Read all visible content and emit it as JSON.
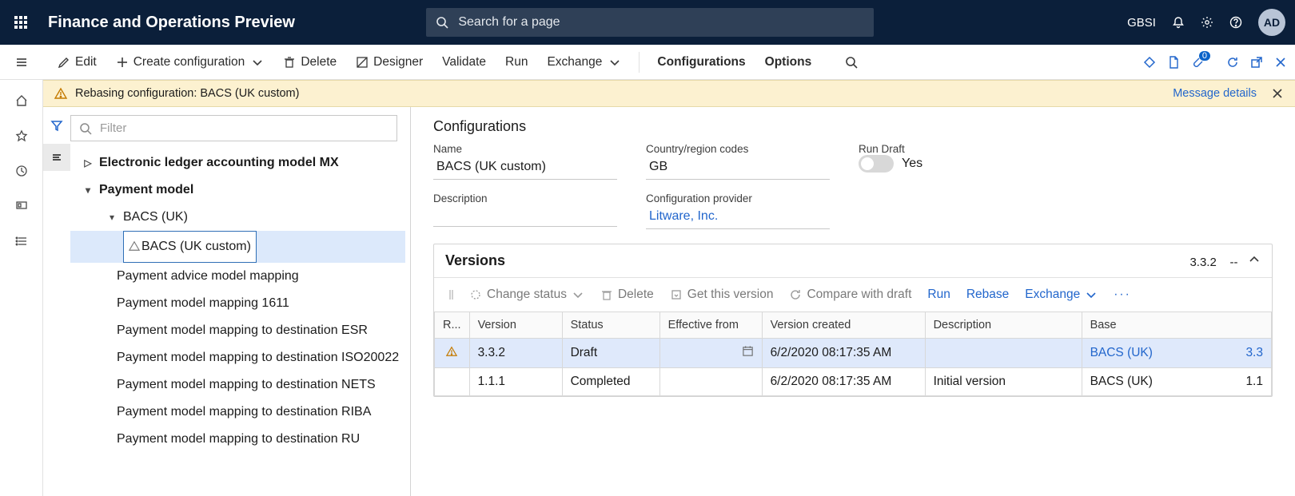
{
  "header": {
    "app_title": "Finance and Operations Preview",
    "search_placeholder": "Search for a page",
    "company": "GBSI",
    "avatar": "AD"
  },
  "commands": {
    "edit": "Edit",
    "create": "Create configuration",
    "delete": "Delete",
    "designer": "Designer",
    "validate": "Validate",
    "run": "Run",
    "exchange": "Exchange",
    "configurations": "Configurations",
    "options": "Options",
    "badge": "0"
  },
  "banner": {
    "text": "Rebasing configuration: BACS (UK custom)",
    "details": "Message details"
  },
  "tree": {
    "filter_placeholder": "Filter",
    "n0": "Electronic ledger accounting model MX",
    "n1": "Payment model",
    "n2": "BACS (UK)",
    "n3": "BACS (UK custom)",
    "c0": "Payment advice model mapping",
    "c1": "Payment model mapping 1611",
    "c2": "Payment model mapping to destination ESR",
    "c3": "Payment model mapping to destination ISO20022",
    "c4": "Payment model mapping to destination NETS",
    "c5": "Payment model mapping to destination RIBA",
    "c6": "Payment model mapping to destination RU"
  },
  "details": {
    "section": "Configurations",
    "labels": {
      "name": "Name",
      "cc": "Country/region codes",
      "run_draft": "Run Draft",
      "desc": "Description",
      "provider": "Configuration provider"
    },
    "name": "BACS (UK custom)",
    "cc": "GB",
    "run_draft": "Yes",
    "provider": "Litware, Inc."
  },
  "versions": {
    "title": "Versions",
    "current": "3.3.2",
    "dash": "--",
    "toolbar": {
      "change": "Change status",
      "delete": "Delete",
      "get": "Get this version",
      "compare": "Compare with draft",
      "run": "Run",
      "rebase": "Rebase",
      "exchange": "Exchange"
    },
    "columns": {
      "r": "R...",
      "ver": "Version",
      "status": "Status",
      "eff": "Effective from",
      "created": "Version created",
      "desc": "Description",
      "base": "Base"
    },
    "rows": [
      {
        "warn": true,
        "ver": "3.3.2",
        "status": "Draft",
        "eff": "",
        "created": "6/2/2020 08:17:35 AM",
        "desc": "",
        "base": "BACS (UK)",
        "basever": "3.3",
        "sel": true,
        "link": true
      },
      {
        "warn": false,
        "ver": "1.1.1",
        "status": "Completed",
        "eff": "",
        "created": "6/2/2020 08:17:35 AM",
        "desc": "Initial version",
        "base": "BACS (UK)",
        "basever": "1.1",
        "sel": false,
        "link": false
      }
    ]
  }
}
